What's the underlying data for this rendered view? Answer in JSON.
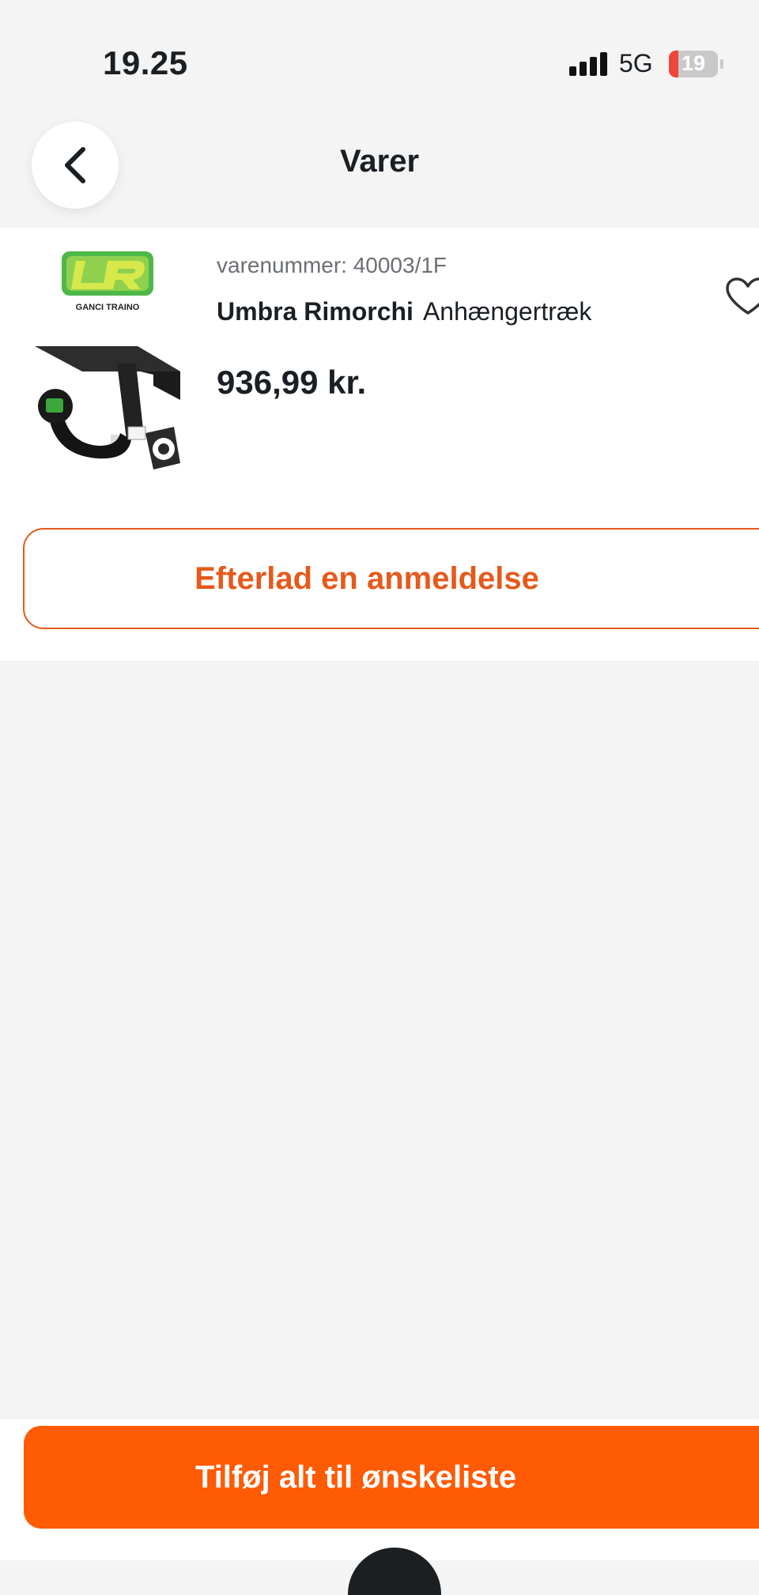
{
  "status_bar": {
    "time": "19.25",
    "network": "5G",
    "battery": "19"
  },
  "header": {
    "title": "Varer"
  },
  "product": {
    "sku": "varenummer: 40003/1F",
    "brand": "Umbra Rimorchi",
    "name": "Anhængertræk",
    "price": "936,99 kr.",
    "logo_text": "GANCI TRAINO",
    "logo_colors": {
      "green": "#4db848",
      "yellow": "#c8e335"
    }
  },
  "actions": {
    "review_label": "Efterlad en anmeldelse",
    "wishlist_label": "Tilføj alt til ønskeliste"
  },
  "colors": {
    "accent": "#ff5a04",
    "outline_accent": "#e55a1c",
    "background": "#f4f4f4"
  },
  "icons": [
    "back-icon",
    "heart-icon",
    "signal-icon",
    "battery-icon"
  ]
}
